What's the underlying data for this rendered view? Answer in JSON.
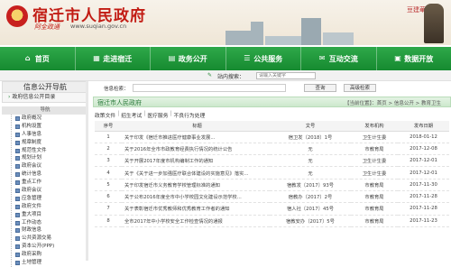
{
  "header": {
    "site_title": "宿迁市人民政府",
    "slogan": "阿全政通",
    "url": "www.suqian.gov.cn",
    "stamp_text": "豆建華"
  },
  "nav": {
    "items": [
      {
        "label": "首页",
        "icon": "home-icon"
      },
      {
        "label": "走进宿迁",
        "icon": "building-icon"
      },
      {
        "label": "政务公开",
        "icon": "doc-icon"
      },
      {
        "label": "公共服务",
        "icon": "service-icon"
      },
      {
        "label": "互动交流",
        "icon": "chat-icon"
      },
      {
        "label": "数据开放",
        "icon": "data-icon"
      }
    ]
  },
  "top_search": {
    "label": "站内搜索：",
    "placeholder": "请输入关键字"
  },
  "sidebar": {
    "title": "信息公开导航",
    "subtitle": "政府信息公开目录",
    "category": "导航",
    "items": [
      "政府概况",
      "机构设置",
      "人事信息",
      "规章制度",
      "规范性文件",
      "规划计划",
      "政府会议",
      "统计信息",
      "重点工作",
      "政府会议",
      "应急管理",
      "政府文件",
      "重大项目",
      "工作动态",
      "财政信息",
      "公共资源交易",
      "资本公开(PPP)",
      "政府采购",
      "土地管理"
    ]
  },
  "main": {
    "search_label": "信息检索：",
    "query_button": "查询",
    "advanced_button": "高级检索",
    "section_title": "宿迁市人民政府",
    "breadcrumb": "【当前位置】：首页 > 信息公开 > 教育卫生",
    "tabs": [
      "政策文件",
      "招生考试",
      "医疗服务",
      "不良行为处理"
    ],
    "columns": {
      "no": "序号",
      "title": "标题",
      "doc_no": "文号",
      "org": "发布机构",
      "date": "发布日期"
    },
    "rows": [
      {
        "no": "1",
        "title": "关于印发《宿迁市推进医疗健康事业发展...",
        "doc_no": "宿卫发〔2018〕1号",
        "org": "卫生计生委",
        "date": "2018-01-12"
      },
      {
        "no": "2",
        "title": "关于2016年全市市政教育经费执行情况的统计公告",
        "doc_no": "无",
        "org": "市教育局",
        "date": "2017-12-08"
      },
      {
        "no": "3",
        "title": "关于开展2017年度市机构编制工作的通知",
        "doc_no": "无",
        "org": "卫生计生委",
        "date": "2017-12-01"
      },
      {
        "no": "4",
        "title": "关于《关于进一步加强医疗联合体建设的实施意见》落实...",
        "doc_no": "无",
        "org": "卫生计生委",
        "date": "2017-12-01"
      },
      {
        "no": "5",
        "title": "关于印发宿迁市义务教育学校管理标准的通知",
        "doc_no": "宿教发〔2017〕93号",
        "org": "市教育局",
        "date": "2017-11-30"
      },
      {
        "no": "6",
        "title": "关于公布2016年度全市中小学校园文化建设示范学校...",
        "doc_no": "宿教办〔2017〕2号",
        "org": "市教育局",
        "date": "2017-11-28"
      },
      {
        "no": "7",
        "title": "关于表彰宿迁市优秀教师和优秀教育工作者的通知",
        "doc_no": "宿人社〔2017〕45号",
        "org": "市教育局",
        "date": "2017-11-28"
      },
      {
        "no": "8",
        "title": "全市2017年中小学校安全工作检查情况的通报",
        "doc_no": "宿教安办〔2017〕5号",
        "org": "市教育局",
        "date": "2017-11-23"
      }
    ]
  }
}
